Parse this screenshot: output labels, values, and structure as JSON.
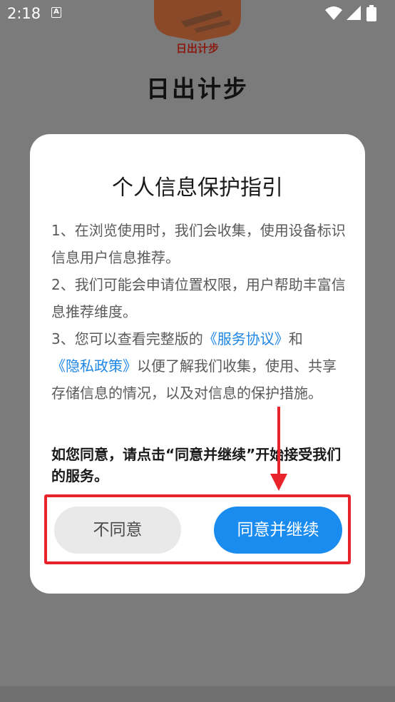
{
  "status_bar": {
    "time": "2:18",
    "notification_letter": "A"
  },
  "app": {
    "logo_text": "日出计步",
    "title": "日出计步"
  },
  "dialog": {
    "title": "个人信息保护指引",
    "para1": "1、在浏览使用时，我们会收集，使用设备标识信息用户信息推荐。",
    "para2": "2、我们可能会申请位置权限，用户帮助丰富信息推荐维度。",
    "para3_prefix": "3、您可以查看完整版的",
    "service_link": "《服务协议》",
    "para3_and": "和",
    "privacy_link": "《隐私政策》",
    "para3_suffix": "以便了解我们收集，使用、共享 存储信息的情况，以及对信息的保护措施。",
    "consent": "如您同意，请点击“同意并继续”开始接受我们的服务。",
    "disagree_label": "不同意",
    "agree_label": "同意并继续"
  },
  "colors": {
    "accent": "#1a8cf0",
    "link": "#1e86e6",
    "annotation": "#e8232a",
    "logo": "#d3621f"
  }
}
